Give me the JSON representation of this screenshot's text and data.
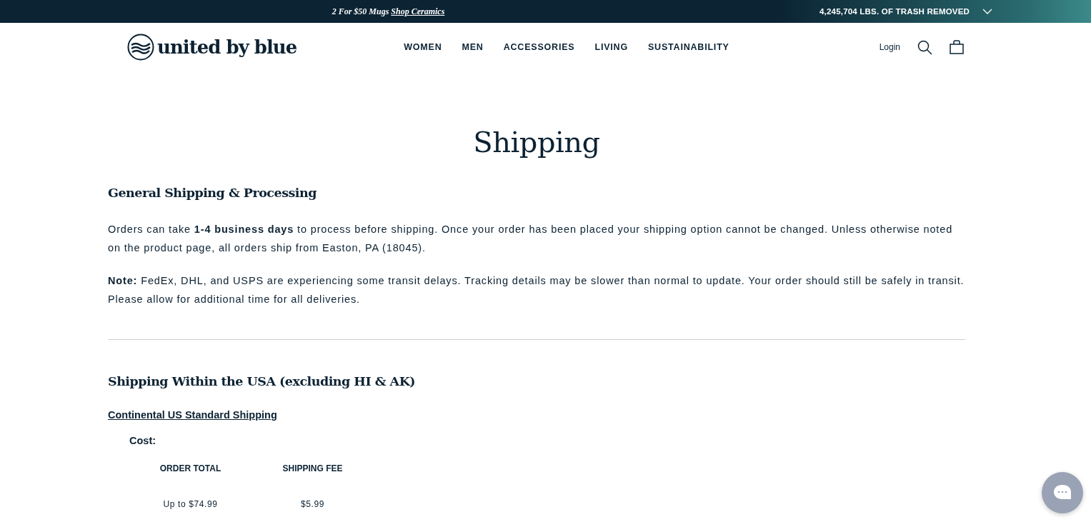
{
  "announcement": {
    "text": "2 For $50 Mugs",
    "link": "Shop Ceramics"
  },
  "trash_counter": {
    "text": "4,245,704 LBS. OF TRASH REMOVED"
  },
  "header": {
    "logo": "united by blue",
    "nav": [
      "WOMEN",
      "MEN",
      "ACCESSORIES",
      "LIVING",
      "SUSTAINABILITY"
    ],
    "login": "Login"
  },
  "page_title": "Shipping",
  "sections": [
    {
      "heading": "General Shipping & Processing",
      "paragraphs": [
        "Orders can take **1-4 business days** to process before shipping. Once your order has been placed your shipping option cannot be changed. Unless otherwise noted on the product page, all orders ship from Easton, PA (18045).",
        "**Note:** FedEx, DHL, and USPS are experiencing some transit delays. Tracking details may be slower than normal to update. Your order should still be safely in transit. Please allow for additional time for all deliveries."
      ]
    },
    {
      "heading": "Shipping Within the USA (excluding HI & AK)",
      "subheading": "Continental US Standard Shipping",
      "cost_label": "Cost:",
      "table": {
        "columns": [
          "ORDER TOTAL",
          "SHIPPING FEE"
        ],
        "rows": [
          [
            "Up to $74.99",
            "$5.99"
          ]
        ]
      }
    }
  ]
}
